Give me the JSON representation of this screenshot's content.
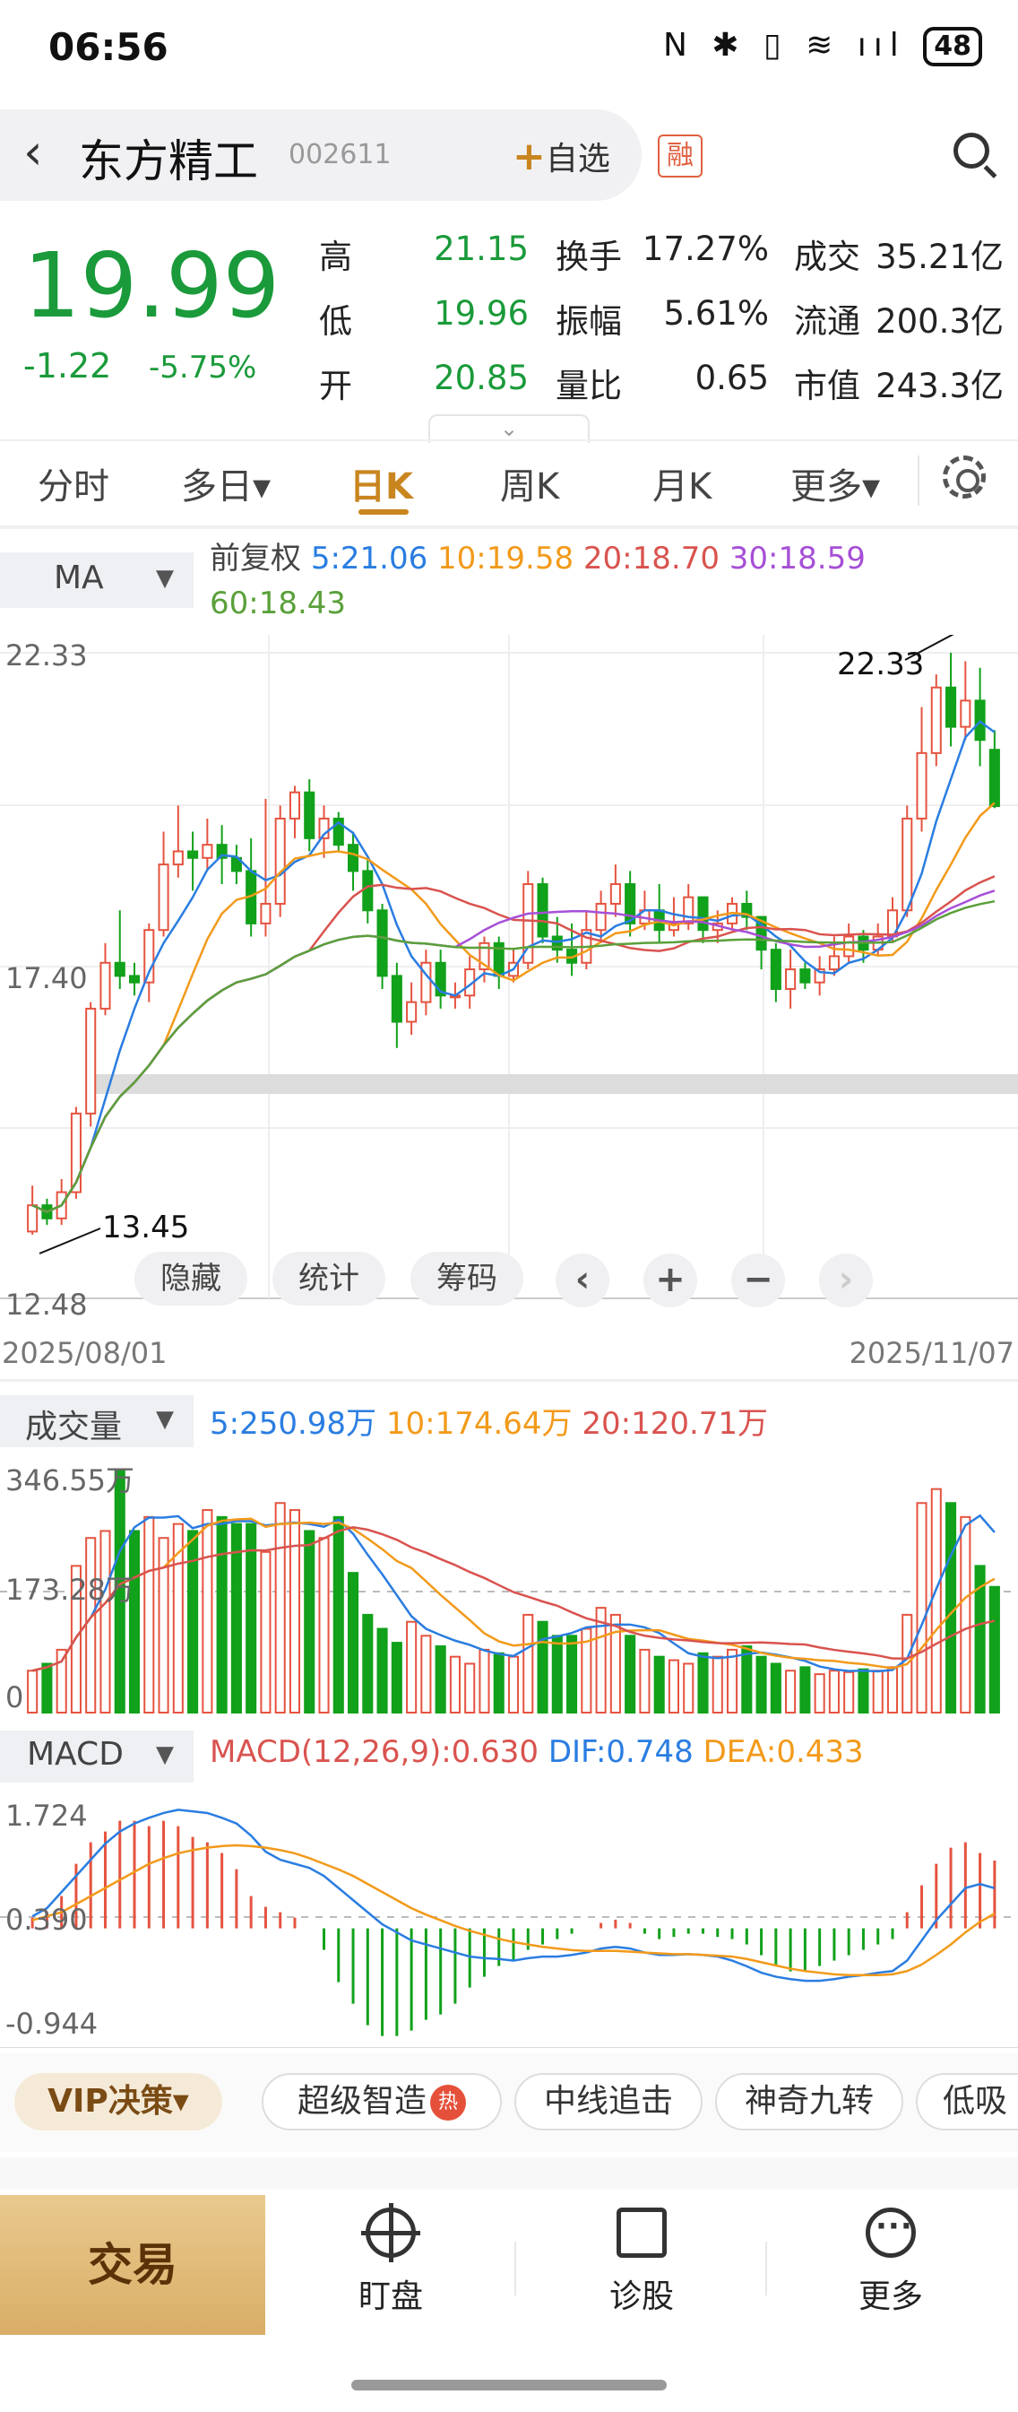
{
  "status_bar": {
    "time": "06:56",
    "icons": "N ✱ ▯ ≋ ııl",
    "battery": "48"
  },
  "header": {
    "back": "‹",
    "name": "东方精工",
    "code": "002611",
    "add_watchlist_plus": "+",
    "add_watchlist": "自选",
    "margin_badge": "融"
  },
  "quote": {
    "price": "19.99",
    "change": "-1.22",
    "change_pct": "-5.75%",
    "stats": [
      {
        "label": "高",
        "value": "21.15",
        "green": true
      },
      {
        "label": "换手",
        "value": "17.27%"
      },
      {
        "label": "成交",
        "value": "35.21亿"
      },
      {
        "label": "低",
        "value": "19.96",
        "green": true
      },
      {
        "label": "振幅",
        "value": "5.61%"
      },
      {
        "label": "流通",
        "value": "200.3亿"
      },
      {
        "label": "开",
        "value": "20.85",
        "green": true
      },
      {
        "label": "量比",
        "value": "0.65"
      },
      {
        "label": "市值",
        "value": "243.3亿"
      }
    ],
    "toggle": "⌄"
  },
  "tabs": [
    "分时",
    "多日▾",
    "日K",
    "周K",
    "月K",
    "更多▾"
  ],
  "ma": {
    "selector": "MA",
    "adjust": "前复权",
    "items": [
      {
        "label": "5:21.06",
        "color": "#2a7de1"
      },
      {
        "label": "10:19.58",
        "color": "#f29a1a"
      },
      {
        "label": "20:18.70",
        "color": "#d9534f"
      },
      {
        "label": "30:18.59",
        "color": "#a64fd6"
      },
      {
        "label": "60:18.43",
        "color": "#5aa03a"
      }
    ]
  },
  "kline_axis": {
    "top": "22.33",
    "mid": "17.40",
    "bottom": "12.48",
    "high_mark": "22.33",
    "low_mark": "13.45"
  },
  "chart_buttons": {
    "hide": "隐藏",
    "stats": "统计",
    "chips": "筹码",
    "prev": "‹",
    "zoom_in": "+",
    "zoom_out": "−",
    "next": "›"
  },
  "dates": {
    "start": "2025/08/01",
    "end": "2025/11/07"
  },
  "volume": {
    "selector": "成交量",
    "items": [
      {
        "label": "5:250.98万",
        "color": "#2a7de1"
      },
      {
        "label": "10:174.64万",
        "color": "#f29a1a"
      },
      {
        "label": "20:120.71万",
        "color": "#d9534f"
      }
    ],
    "axis": {
      "top": "346.55万",
      "mid": "173.28万",
      "bottom": "0"
    }
  },
  "macd": {
    "selector": "MACD",
    "items": [
      {
        "label": "MACD(12,26,9):0.630",
        "color": "#d9534f"
      },
      {
        "label": "DIF:0.748",
        "color": "#2a7de1"
      },
      {
        "label": "DEA:0.433",
        "color": "#f29a1a"
      }
    ],
    "axis": {
      "top": "1.724",
      "mid": "0.390",
      "bottom": "-0.944"
    }
  },
  "strategies": {
    "vip": "VIP决策▾",
    "hot": "热",
    "chips": [
      "超级智造",
      "中线追击",
      "神奇九转",
      "低吸"
    ]
  },
  "bottom_nav": {
    "trade": "交易",
    "monitor": "盯盘",
    "diagnose": "诊股",
    "more": "更多"
  },
  "chart_data": {
    "type": "candlestick",
    "x_range": [
      "2025/08/01",
      "2025/11/07"
    ],
    "ylim": [
      12.48,
      22.33
    ],
    "candles": [
      [
        13.5,
        13.9,
        13.45,
        14.2
      ],
      [
        13.9,
        13.7,
        13.6,
        14.0
      ],
      [
        13.7,
        14.1,
        13.6,
        14.3
      ],
      [
        14.1,
        15.3,
        14.0,
        15.4
      ],
      [
        15.3,
        16.9,
        15.1,
        17.0
      ],
      [
        16.9,
        17.6,
        16.8,
        17.9
      ],
      [
        17.6,
        17.4,
        17.2,
        18.4
      ],
      [
        17.4,
        17.3,
        17.1,
        17.6
      ],
      [
        17.3,
        18.1,
        17.0,
        18.2
      ],
      [
        18.1,
        19.1,
        18.0,
        19.6
      ],
      [
        19.1,
        19.3,
        18.9,
        20.0
      ],
      [
        19.3,
        19.2,
        18.7,
        19.6
      ],
      [
        19.2,
        19.4,
        19.0,
        19.8
      ],
      [
        19.4,
        19.2,
        18.8,
        19.7
      ],
      [
        19.2,
        19.0,
        18.8,
        19.4
      ],
      [
        19.0,
        18.2,
        18.0,
        19.5
      ],
      [
        18.2,
        18.5,
        18.0,
        20.1
      ],
      [
        18.5,
        19.8,
        18.3,
        20.0
      ],
      [
        19.8,
        20.2,
        19.5,
        20.3
      ],
      [
        20.2,
        19.5,
        19.3,
        20.4
      ],
      [
        19.5,
        19.8,
        19.2,
        20.0
      ],
      [
        19.8,
        19.4,
        19.3,
        19.9
      ],
      [
        19.4,
        19.0,
        18.7,
        19.6
      ],
      [
        19.0,
        18.4,
        18.2,
        19.2
      ],
      [
        18.4,
        17.4,
        17.2,
        18.5
      ],
      [
        17.4,
        16.7,
        16.3,
        17.6
      ],
      [
        16.7,
        17.0,
        16.5,
        17.3
      ],
      [
        17.0,
        17.6,
        16.8,
        17.8
      ],
      [
        17.6,
        17.1,
        16.9,
        17.8
      ],
      [
        17.1,
        17.1,
        16.9,
        17.3
      ],
      [
        17.1,
        17.5,
        16.9,
        17.7
      ],
      [
        17.5,
        17.9,
        17.3,
        18.0
      ],
      [
        17.9,
        17.4,
        17.2,
        18.0
      ],
      [
        17.4,
        17.6,
        17.3,
        17.8
      ],
      [
        17.6,
        18.8,
        17.5,
        19.0
      ],
      [
        18.8,
        18.0,
        17.9,
        18.9
      ],
      [
        18.0,
        17.8,
        17.6,
        18.3
      ],
      [
        17.8,
        17.6,
        17.4,
        18.2
      ],
      [
        17.6,
        18.1,
        17.5,
        18.4
      ],
      [
        18.1,
        18.5,
        17.9,
        18.7
      ],
      [
        18.5,
        18.8,
        18.3,
        19.1
      ],
      [
        18.8,
        18.2,
        18.0,
        19.0
      ],
      [
        18.2,
        18.4,
        18.1,
        18.7
      ],
      [
        18.4,
        18.1,
        17.9,
        18.8
      ],
      [
        18.1,
        18.2,
        18.0,
        18.6
      ],
      [
        18.2,
        18.6,
        18.1,
        18.8
      ],
      [
        18.6,
        18.1,
        17.9,
        18.6
      ],
      [
        18.1,
        18.2,
        17.9,
        18.4
      ],
      [
        18.2,
        18.5,
        18.1,
        18.6
      ],
      [
        18.5,
        18.3,
        18.1,
        18.7
      ],
      [
        18.3,
        17.8,
        17.5,
        18.3
      ],
      [
        17.8,
        17.2,
        17.0,
        17.9
      ],
      [
        17.2,
        17.5,
        16.9,
        17.8
      ],
      [
        17.5,
        17.3,
        17.2,
        17.6
      ],
      [
        17.3,
        17.5,
        17.1,
        17.7
      ],
      [
        17.5,
        17.7,
        17.4,
        18.0
      ],
      [
        17.7,
        18.0,
        17.6,
        18.2
      ],
      [
        18.0,
        17.8,
        17.6,
        18.1
      ],
      [
        17.8,
        18.0,
        17.7,
        18.2
      ],
      [
        18.0,
        18.4,
        17.9,
        18.6
      ],
      [
        18.4,
        19.8,
        18.3,
        20.0
      ],
      [
        19.8,
        20.8,
        19.6,
        21.5
      ],
      [
        20.8,
        21.8,
        20.6,
        22.0
      ],
      [
        21.8,
        21.2,
        20.9,
        22.33
      ],
      [
        21.2,
        21.6,
        21.0,
        22.2
      ],
      [
        21.6,
        21.0,
        20.6,
        22.1
      ],
      [
        20.85,
        19.99,
        19.96,
        21.15
      ]
    ],
    "volume_ylim": [
      0,
      346.55
    ],
    "volume": [
      60,
      70,
      90,
      210,
      250,
      260,
      346,
      260,
      280,
      250,
      270,
      260,
      290,
      280,
      270,
      270,
      230,
      300,
      290,
      260,
      250,
      280,
      200,
      140,
      120,
      100,
      130,
      110,
      95,
      80,
      70,
      90,
      85,
      80,
      140,
      130,
      110,
      110,
      120,
      150,
      140,
      110,
      90,
      80,
      75,
      70,
      85,
      80,
      90,
      95,
      80,
      70,
      60,
      65,
      55,
      60,
      58,
      62,
      60,
      65,
      140,
      300,
      320,
      300,
      280,
      210,
      180
    ],
    "macd_ylim": [
      -0.944,
      1.724
    ],
    "macd_hist": [
      0.1,
      0.15,
      0.3,
      0.6,
      0.8,
      0.9,
      1.0,
      1.0,
      0.95,
      1.0,
      0.95,
      0.85,
      0.8,
      0.7,
      0.55,
      0.3,
      0.2,
      0.15,
      0.1,
      0.0,
      -0.2,
      -0.5,
      -0.7,
      -0.9,
      -1.0,
      -1.0,
      -0.95,
      -0.85,
      -0.8,
      -0.7,
      -0.55,
      -0.45,
      -0.35,
      -0.3,
      -0.2,
      -0.15,
      -0.1,
      -0.05,
      0.0,
      0.05,
      0.08,
      0.05,
      -0.05,
      -0.1,
      -0.08,
      -0.05,
      -0.05,
      -0.08,
      -0.1,
      -0.15,
      -0.25,
      -0.35,
      -0.4,
      -0.4,
      -0.35,
      -0.3,
      -0.25,
      -0.2,
      -0.15,
      -0.1,
      0.15,
      0.4,
      0.6,
      0.75,
      0.8,
      0.7,
      0.63
    ],
    "dif": [
      0.4,
      0.5,
      0.7,
      0.9,
      1.1,
      1.3,
      1.45,
      1.55,
      1.62,
      1.68,
      1.72,
      1.7,
      1.68,
      1.62,
      1.55,
      1.4,
      1.2,
      1.1,
      1.05,
      1.0,
      0.9,
      0.75,
      0.6,
      0.45,
      0.3,
      0.2,
      0.1,
      0.05,
      0.0,
      -0.05,
      -0.1,
      -0.12,
      -0.13,
      -0.15,
      -0.12,
      -0.1,
      -0.1,
      -0.08,
      -0.05,
      0.0,
      0.02,
      0.0,
      -0.05,
      -0.08,
      -0.08,
      -0.07,
      -0.08,
      -0.1,
      -0.15,
      -0.22,
      -0.3,
      -0.35,
      -0.38,
      -0.4,
      -0.4,
      -0.38,
      -0.35,
      -0.33,
      -0.3,
      -0.28,
      -0.15,
      0.1,
      0.35,
      0.55,
      0.75,
      0.8,
      0.748
    ],
    "dea": [
      0.35,
      0.4,
      0.45,
      0.55,
      0.65,
      0.75,
      0.85,
      0.95,
      1.05,
      1.12,
      1.18,
      1.22,
      1.25,
      1.27,
      1.28,
      1.27,
      1.25,
      1.22,
      1.18,
      1.12,
      1.05,
      0.98,
      0.9,
      0.8,
      0.7,
      0.6,
      0.5,
      0.42,
      0.35,
      0.28,
      0.22,
      0.17,
      0.12,
      0.08,
      0.05,
      0.02,
      0.0,
      -0.02,
      -0.03,
      -0.03,
      -0.03,
      -0.04,
      -0.05,
      -0.06,
      -0.07,
      -0.07,
      -0.08,
      -0.09,
      -0.1,
      -0.13,
      -0.17,
      -0.21,
      -0.25,
      -0.28,
      -0.3,
      -0.32,
      -0.33,
      -0.33,
      -0.33,
      -0.32,
      -0.28,
      -0.2,
      -0.08,
      0.05,
      0.2,
      0.33,
      0.433
    ]
  }
}
